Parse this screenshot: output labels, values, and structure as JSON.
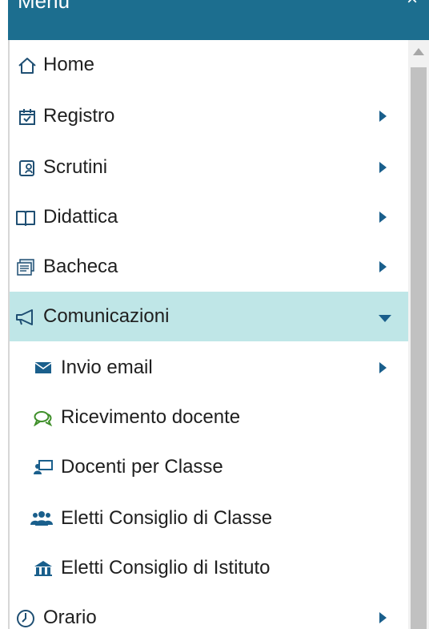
{
  "header": {
    "title": "Menu",
    "close_icon": "×"
  },
  "colors": {
    "header_bg": "#1c6e8f",
    "active_bg": "#bfe6e7",
    "arrow": "#1a5f8c",
    "highlight": "#fff235"
  },
  "menu": {
    "items": [
      {
        "label": "Home",
        "icon": "home-icon",
        "has_submenu": false
      },
      {
        "label": "Registro",
        "icon": "calendar-check-icon",
        "has_submenu": true
      },
      {
        "label": "Scrutini",
        "icon": "scrutini-icon",
        "has_submenu": true
      },
      {
        "label": "Didattica",
        "icon": "book-open-icon",
        "has_submenu": true
      },
      {
        "label": "Bacheca",
        "icon": "bulletin-board-icon",
        "has_submenu": true
      },
      {
        "label": "Comunicazioni",
        "icon": "megaphone-icon",
        "has_submenu": true,
        "expanded": true
      },
      {
        "label": "Invio email",
        "icon": "envelope-icon",
        "has_submenu": true
      },
      {
        "label": "Ricevimento docente",
        "icon": "chat-bubbles-icon",
        "has_submenu": false,
        "highlighted": true
      },
      {
        "label": "Docenti per Classe",
        "icon": "teacher-board-icon",
        "has_submenu": false
      },
      {
        "label": "Eletti Consiglio di Classe",
        "icon": "users-group-icon",
        "has_submenu": false
      },
      {
        "label": "Eletti Consiglio di Istituto",
        "icon": "institute-icon",
        "has_submenu": false
      },
      {
        "label": "Orario",
        "icon": "clock-icon",
        "has_submenu": true
      }
    ]
  }
}
